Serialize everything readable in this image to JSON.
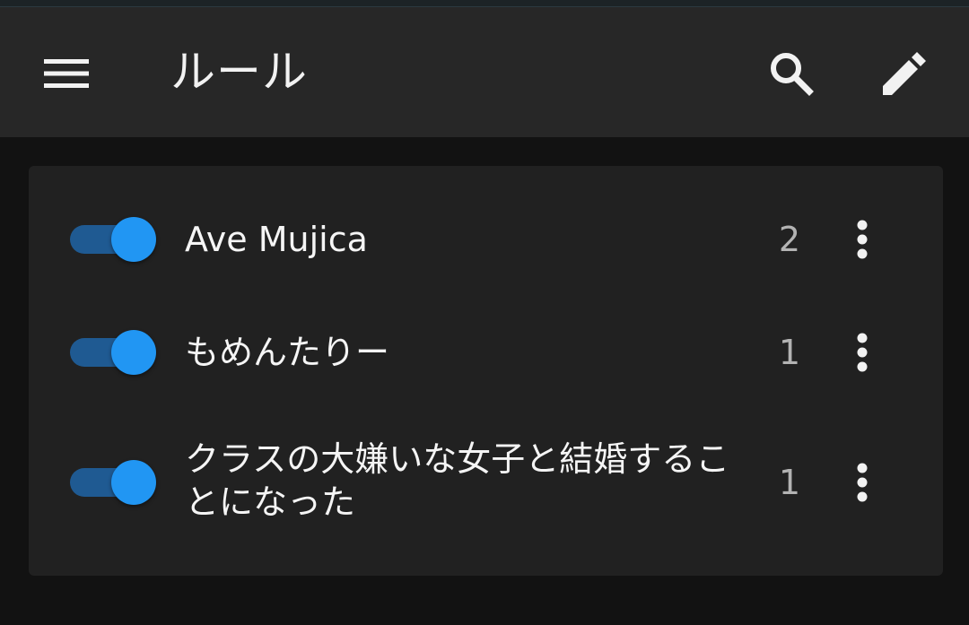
{
  "appbar": {
    "title": "ルール",
    "icons": [
      "menu-icon",
      "search-icon",
      "edit-icon"
    ]
  },
  "rules": [
    {
      "name": "Ave Mujica",
      "count": "2",
      "enabled": true
    },
    {
      "name": "もめんたりー",
      "count": "1",
      "enabled": true
    },
    {
      "name": "クラスの大嫌いな女子と結婚することになった",
      "count": "1",
      "enabled": true
    }
  ],
  "colors": {
    "background": "#121212",
    "appbar": "#272727",
    "card": "#212121",
    "toggle_thumb": "#2196f3",
    "toggle_track": "#1f5a92",
    "count_text": "#b3b3b3"
  }
}
